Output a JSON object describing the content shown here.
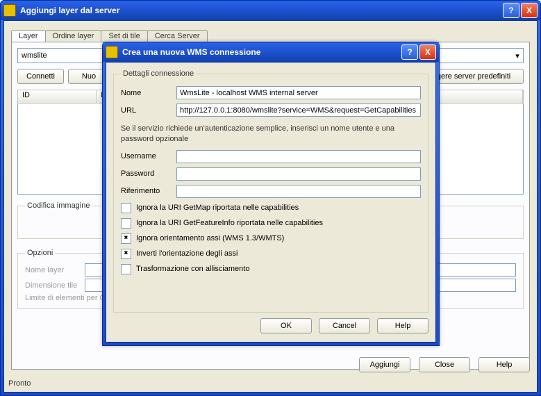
{
  "outer": {
    "title": "Aggiungi layer dal server",
    "help_glyph": "?",
    "close_glyph": "X",
    "tabs": {
      "layer": "Layer",
      "ordine": "Ordine layer",
      "set": "Set di tile",
      "cerca": "Cerca Server"
    },
    "combo_value": "wmslite",
    "buttons": {
      "connetti": "Connetti",
      "nuovo": "Nuo",
      "predef": "ngere server predefiniti"
    },
    "list_headers": {
      "id": "ID",
      "nome": "Nom"
    },
    "group_codifica": "Codifica immagine",
    "group_opzioni": "Opzioni",
    "opzioni": {
      "nome_layer": "Nome layer",
      "dim_tile": "Dimensione tile",
      "limite": "Limite di elementi per G"
    },
    "bottom": {
      "aggiungi": "Aggiungi",
      "close": "Close",
      "help": "Help"
    },
    "status": "Pronto"
  },
  "modal": {
    "title": "Crea una nuova WMS connessione",
    "help_glyph": "?",
    "close_glyph": "X",
    "group": "Dettagli connessione",
    "labels": {
      "nome": "Nome",
      "url": "URL",
      "username": "Username",
      "password": "Password",
      "riferimento": "Riferimento"
    },
    "values": {
      "nome": "WmsLite - localhost WMS internal server",
      "url": "http://127.0.0.1:8080/wmslite?service=WMS&request=GetCapabilities",
      "username": "",
      "password": "",
      "riferimento": ""
    },
    "hint": "Se il servizio richiede un'autenticazione semplice, inserisci un nome utente e una password opzionale",
    "checks": {
      "ignora_getmap": {
        "label": "Ignora la URI GetMap riportata nelle capabilities",
        "checked": false
      },
      "ignora_getfeature": {
        "label": "Ignora la URI GetFeatureInfo riportata nelle capabilities",
        "checked": false
      },
      "ignora_orient": {
        "label": "Ignora orientamento assi (WMS 1.3/WMTS)",
        "checked": true
      },
      "inverti": {
        "label": "Inverti l'orientazione degli assi",
        "checked": true
      },
      "trasf": {
        "label": "Trasformazione con allisciamento",
        "checked": false
      }
    },
    "buttons": {
      "ok": "OK",
      "cancel": "Cancel",
      "help": "Help"
    }
  }
}
